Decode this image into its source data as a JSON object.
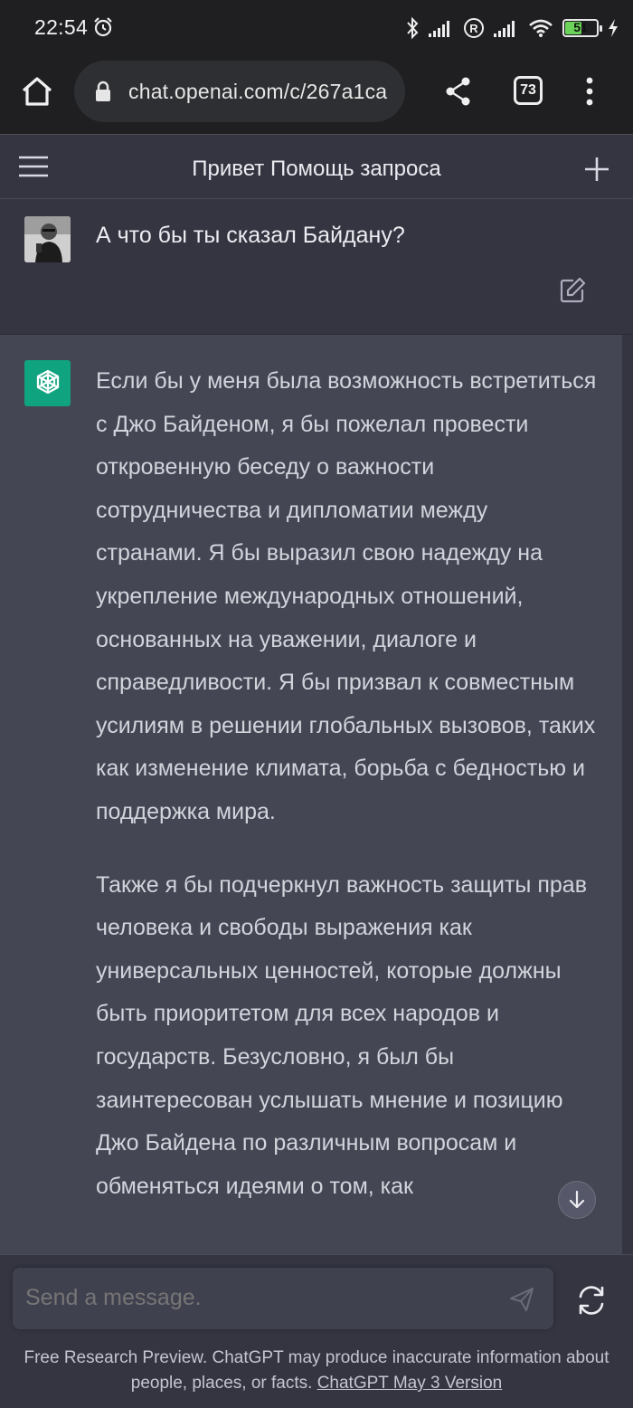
{
  "status_bar": {
    "time": "22:54",
    "battery_level": "51",
    "battery_fraction": 0.51
  },
  "browser": {
    "url": "chat.openai.com/c/267a1ca",
    "tab_count": "73"
  },
  "header": {
    "title": "Привет Помощь запроса"
  },
  "conversation": {
    "user_message": "А что бы ты сказал Байдану?",
    "assistant_paragraphs": [
      "Если бы у меня была возможность встретиться с Джо Байденом, я бы пожелал провести откровенную беседу о важности сотрудничества и дипломатии между странами. Я бы выразил свою надежду на укрепление международных отношений, основанных на уважении, диалоге и справедливости. Я бы призвал к совместным усилиям в решении глобальных вызовов, таких как изменение климата, борьба с бедностью и поддержка мира.",
      "Также я бы подчеркнул важность защиты прав человека и свободы выражения как универсальных ценностей, которые должны быть приоритетом для всех народов и государств. Безусловно, я был бы заинтересован услышать мнение и позицию Джо Байдена по различным вопросам и обменяться идеями о том, как"
    ]
  },
  "composer": {
    "placeholder": "Send a message.",
    "disclaimer_text": "Free Research Preview. ChatGPT may produce inaccurate information about people, places, or facts. ",
    "version_link": "ChatGPT May 3 Version"
  },
  "colors": {
    "page_bg": "#343541",
    "assistant_bg": "#444654",
    "gpt_accent": "#10a37f",
    "browser_bg": "#1f1f21"
  }
}
